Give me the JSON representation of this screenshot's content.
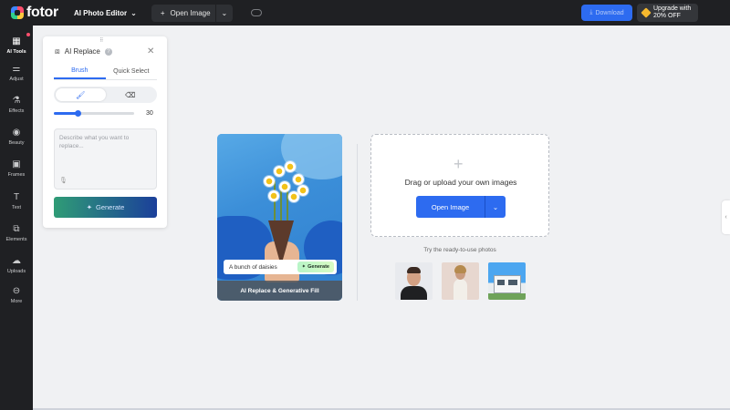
{
  "brand": {
    "logo_text": "fotor"
  },
  "topbar": {
    "editor_label": "AI Photo Editor",
    "open_image_label": "Open Image",
    "download_label": "Download",
    "upgrade_line1": "Upgrade with",
    "upgrade_line2": "20% OFF"
  },
  "rail": {
    "items": [
      {
        "label": "AI Tools",
        "icon": "grid-icon",
        "active": true
      },
      {
        "label": "Adjust",
        "icon": "sliders-icon"
      },
      {
        "label": "Effects",
        "icon": "flask-icon"
      },
      {
        "label": "Beauty",
        "icon": "eye-icon"
      },
      {
        "label": "Frames",
        "icon": "frame-icon"
      },
      {
        "label": "Text",
        "icon": "text-icon"
      },
      {
        "label": "Elements",
        "icon": "shapes-icon"
      },
      {
        "label": "Uploads",
        "icon": "cloud-upload-icon"
      },
      {
        "label": "More",
        "icon": "more-icon"
      }
    ]
  },
  "panel": {
    "title": "AI Replace",
    "tabs": [
      "Brush",
      "Quick Select"
    ],
    "active_tab": "Brush",
    "brush_size": "30",
    "brush_size_fraction": 0.3,
    "prompt_placeholder": "Describe what you want to replace...",
    "generate_label": "Generate"
  },
  "showcase": {
    "prompt_chip": "A bunch of daisies",
    "chip_button": "Generate",
    "caption": "AI Replace & Generative Fill"
  },
  "upload": {
    "instruction": "Drag or upload your own images",
    "button_label": "Open Image",
    "try_text": "Try the ready-to-use photos"
  },
  "colors": {
    "accent": "#2d6bf0",
    "topbar_bg": "#1f2023",
    "canvas_bg": "#f0f1f3"
  }
}
